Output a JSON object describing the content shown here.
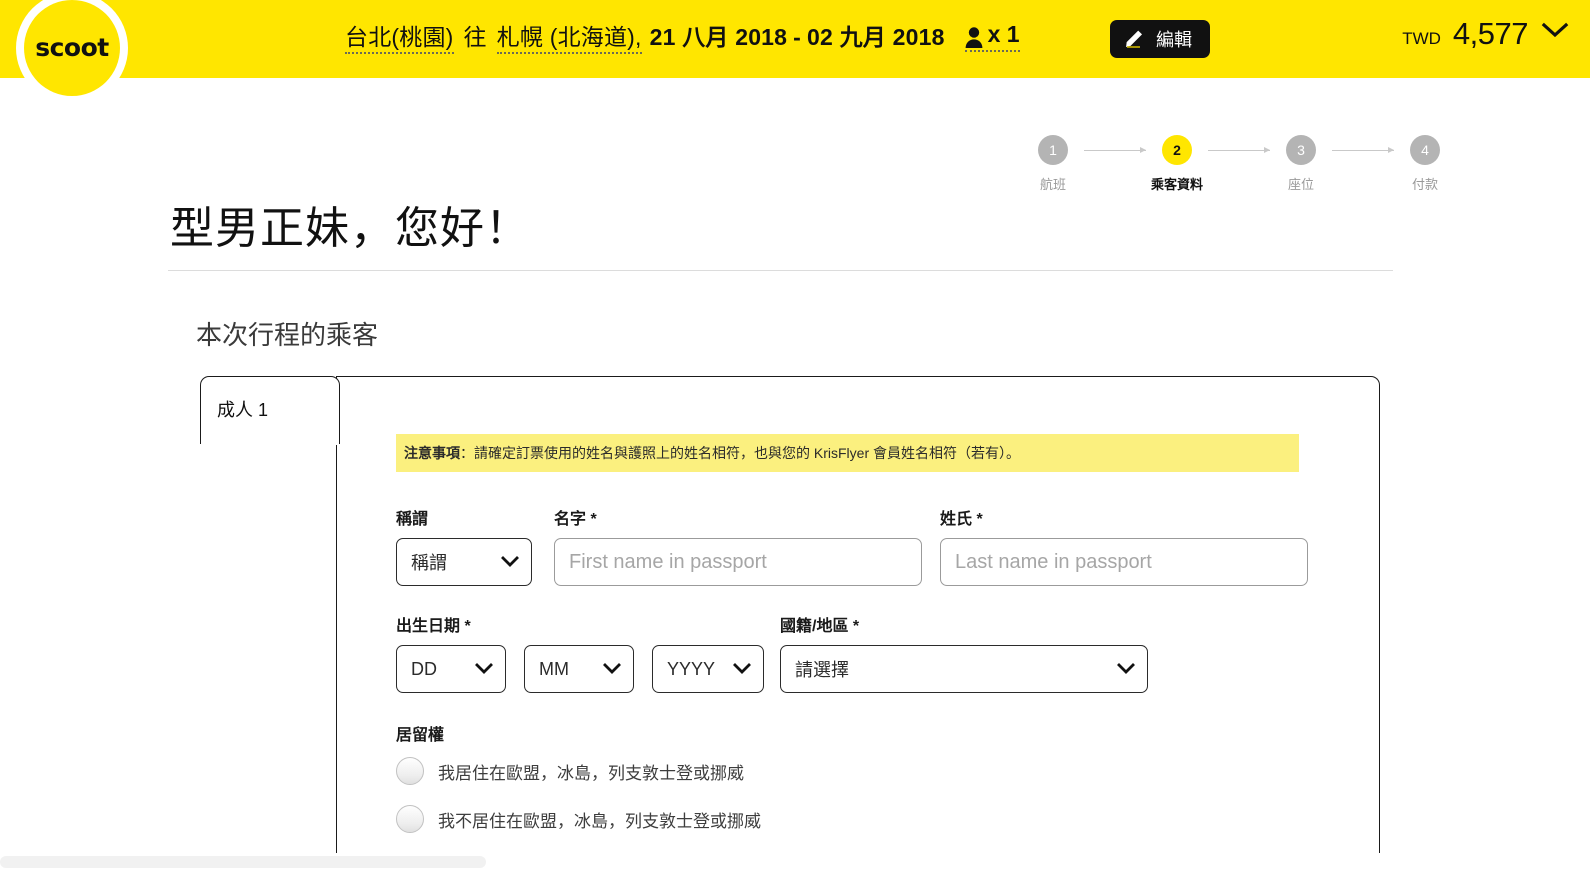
{
  "brand": {
    "logo_text": "scoot",
    "yellow": "#ffe600",
    "black": "#111111"
  },
  "header": {
    "route": {
      "origin": "台北(桃園)",
      "connector": "往",
      "destination": "札幌 (北海道),",
      "depart_date": "21 八月 2018",
      "dash": "-",
      "return_date": "02 九月 2018"
    },
    "pax": {
      "icon": "person-icon",
      "label": "x 1"
    },
    "edit_button": {
      "icon": "pencil-icon",
      "label": "編輯"
    },
    "price": {
      "currency": "TWD",
      "amount": "4,577",
      "chevron": "chevron-down-icon"
    }
  },
  "stepper": {
    "steps": [
      {
        "number": "1",
        "label": "航班",
        "active": false
      },
      {
        "number": "2",
        "label": "乘客資料",
        "active": true
      },
      {
        "number": "3",
        "label": "座位",
        "active": false
      },
      {
        "number": "4",
        "label": "付款",
        "active": false
      }
    ]
  },
  "page": {
    "greeting": "型男正妹，您好！",
    "section_title": "本次行程的乘客"
  },
  "passenger": {
    "tab_label": "成人 1",
    "note": {
      "bold_prefix": "注意事項",
      "body": "：請確定訂票使用的姓名與護照上的姓名相符，也與您的 KrisFlyer 會員姓名相符（若有）。"
    },
    "fields": {
      "title": {
        "label": "稱謂",
        "value": "稱謂"
      },
      "first_name": {
        "label": "名字 *",
        "placeholder": "First name in passport",
        "value": ""
      },
      "last_name": {
        "label": "姓氏 *",
        "placeholder": "Last name in passport",
        "value": ""
      },
      "dob": {
        "label": "出生日期 *",
        "day": "DD",
        "month": "MM",
        "year": "YYYY"
      },
      "nationality": {
        "label": "國籍/地區 *",
        "value": "請選擇"
      }
    },
    "residency": {
      "label": "居留權",
      "options": [
        "我居住在歐盟，冰島，列支敦士登或挪威",
        "我不居住在歐盟，冰島，列支敦士登或挪威"
      ]
    }
  }
}
